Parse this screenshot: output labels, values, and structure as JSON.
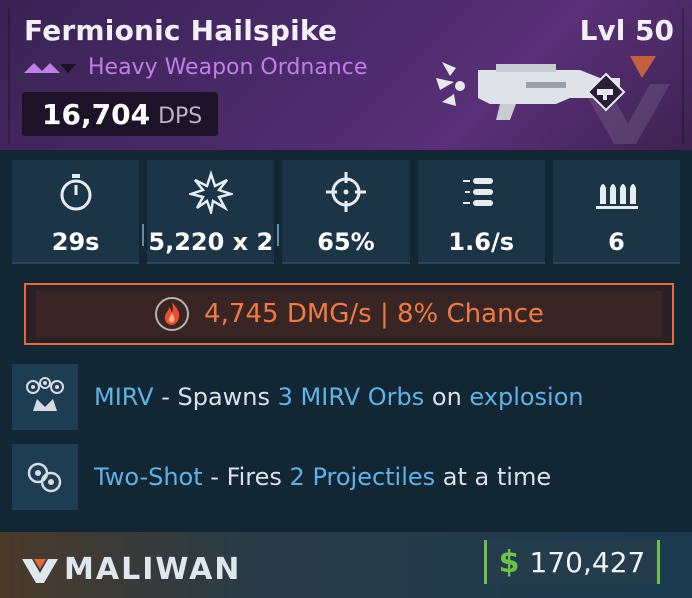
{
  "weapon": {
    "name": "Fermionic Hailspike",
    "level": "Lvl 50",
    "type": "Heavy Weapon Ordnance",
    "dps_value": "16,704",
    "dps_unit": "DPS"
  },
  "stats": [
    {
      "icon": "stopwatch-icon",
      "value": "29s"
    },
    {
      "icon": "damage-burst-icon",
      "value": "5,220 x 2"
    },
    {
      "icon": "crosshair-icon",
      "value": "65%"
    },
    {
      "icon": "fire-rate-bullets-icon",
      "value": "1.6/s"
    },
    {
      "icon": "ammo-icon",
      "value": "6"
    }
  ],
  "element": {
    "icon": "incendiary-flame-icon",
    "text": "4,745 DMG/s | 8% Chance",
    "color": "#f07a43"
  },
  "perks": [
    {
      "icon": "mirv-icon",
      "name": "MIRV",
      "sep": " - Spawns ",
      "hl1": "3 MIRV Orbs",
      "mid": " on ",
      "hl2": "explosion",
      "end": ""
    },
    {
      "icon": "two-shot-icon",
      "name": "Two-Shot",
      "sep": " - Fires ",
      "hl1": "2 Projectiles",
      "mid": " at a time",
      "hl2": "",
      "end": ""
    }
  ],
  "manufacturer": "MALIWAN",
  "price": {
    "currency_symbol": "$",
    "amount": "170,427"
  },
  "colors": {
    "rarity": "#c07ee8",
    "accent_blue": "#5fb2e6",
    "price_green": "#6cc24a"
  }
}
